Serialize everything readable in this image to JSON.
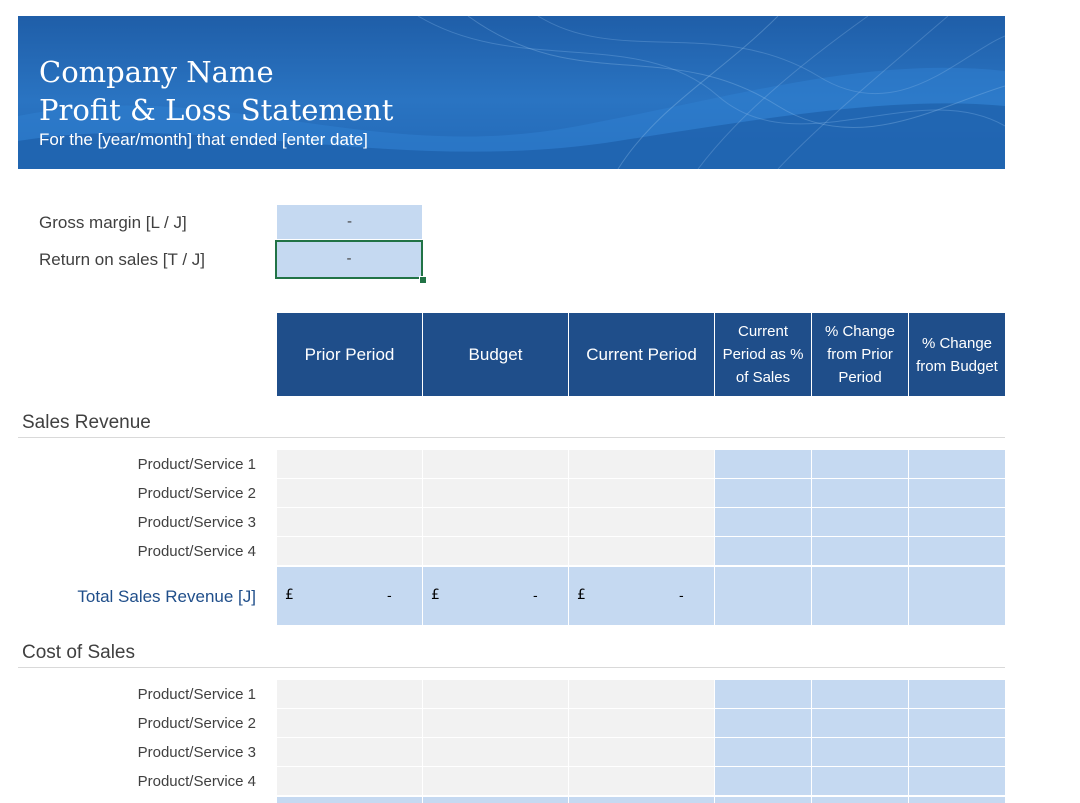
{
  "header": {
    "company": "Company Name",
    "statement": "Profit & Loss Statement",
    "subtitle": "For the [year/month] that ended [enter date]"
  },
  "metrics": [
    {
      "label": "Gross margin  [L / J]",
      "value": "-"
    },
    {
      "label": "Return on sales  [T / J]",
      "value": "-"
    }
  ],
  "columns": [
    "Prior Period",
    "Budget",
    "Current Period",
    "Current Period as % of Sales",
    "% Change from Prior Period",
    "% Change from Budget"
  ],
  "sales": {
    "title": "Sales Revenue",
    "rows": [
      "Product/Service 1",
      "Product/Service 2",
      "Product/Service 3",
      "Product/Service 4"
    ],
    "total_label": "Total Sales Revenue  [J]",
    "currency": "£",
    "total_values": [
      "-",
      "-",
      "-"
    ]
  },
  "cost": {
    "title": "Cost of Sales",
    "rows": [
      "Product/Service 1",
      "Product/Service 2",
      "Product/Service 3",
      "Product/Service 4"
    ]
  },
  "colors": {
    "header_blue": "#1f4e8a",
    "light_blue": "#c5d9f1",
    "grey_cell": "#f2f2f2",
    "selection_green": "#217346"
  }
}
